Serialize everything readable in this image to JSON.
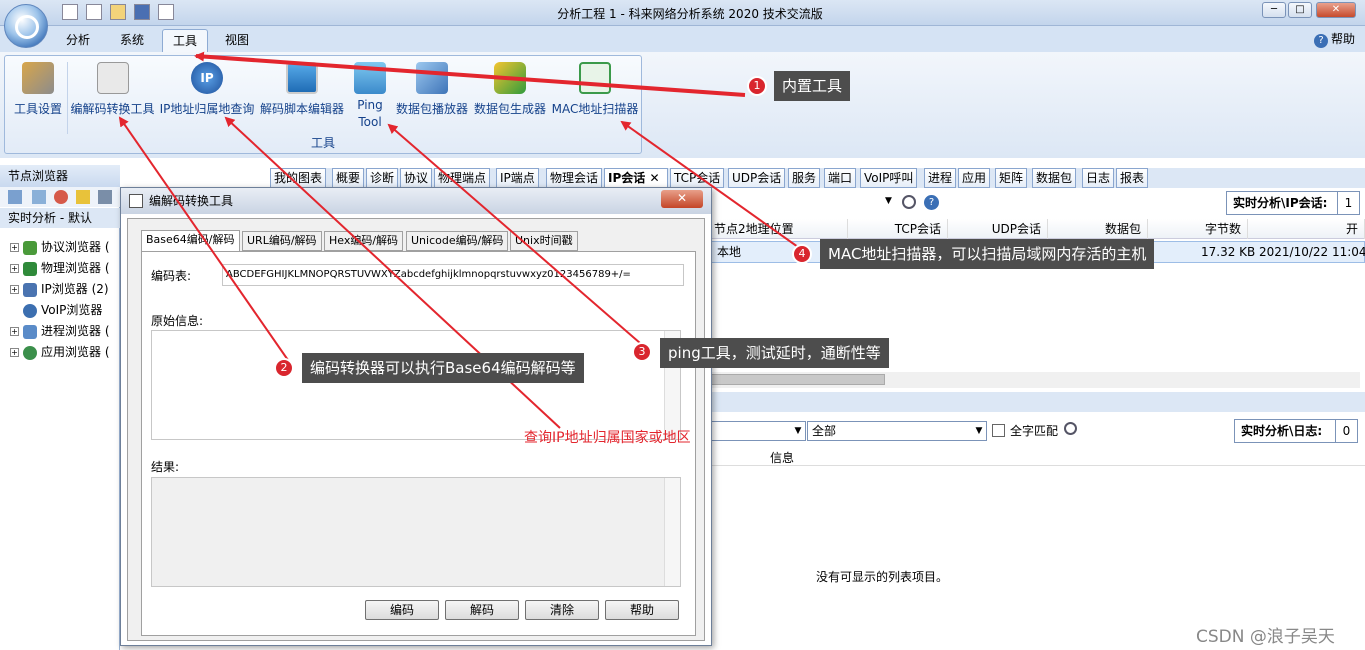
{
  "window": {
    "title": "分析工程 1 - 科来网络分析系统 2020 技术交流版",
    "min": "─",
    "max": "□",
    "close": "✕"
  },
  "menu": {
    "tabs": [
      "分析",
      "系统",
      "工具",
      "视图"
    ],
    "help": "帮助"
  },
  "ribbon": {
    "buttons": [
      "工具设置",
      "编解码转换工具",
      "IP地址归属地查询",
      "解码脚本编辑器",
      "Ping\nTool",
      "数据包播放器",
      "数据包生成器",
      "MAC地址扫描器"
    ],
    "group_label": "工具"
  },
  "node_browser": {
    "title": "节点浏览器",
    "realtime": "实时分析 - 默认",
    "items": [
      "协议浏览器 (",
      "物理浏览器 (",
      "IP浏览器 (2)",
      "VoIP浏览器",
      "进程浏览器 (",
      "应用浏览器 ("
    ]
  },
  "view_tabs": [
    "我的图表",
    "概要",
    "诊断",
    "协议",
    "物理端点",
    "IP端点",
    "物理会话",
    "IP会话",
    "TCP会话",
    "UDP会话",
    "服务",
    "端口",
    "VoIP呼叫",
    "进程",
    "应用",
    "矩阵",
    "数据包",
    "日志",
    "报表"
  ],
  "ip_session": {
    "rt_label": "实时分析\\IP会话:",
    "rt_count": "1",
    "columns": [
      "节点2地理位置",
      "TCP会话",
      "UDP会话",
      "数据包",
      "字节数",
      "开"
    ],
    "row": {
      "location": "本地",
      "bytes": "17.32 KB",
      "time": "2021/10/22 11:04:"
    }
  },
  "log": {
    "filter_all": "全部",
    "full_match": "全字匹配",
    "rt_label": "实时分析\\日志:",
    "rt_count": "0",
    "col_info": "信息",
    "empty": "没有可显示的列表项目。"
  },
  "dialog": {
    "title": "编解码转换工具",
    "close": "✕",
    "tabs": [
      "Base64编码/解码",
      "URL编码/解码",
      "Hex编码/解码",
      "Unicode编码/解码",
      "Unix时间戳"
    ],
    "code_table_label": "编码表:",
    "code_table": "ABCDEFGHIJKLMNOPQRSTUVWXYZabcdefghijklmnopqrstuvwxyz0123456789+/=",
    "original_label": "原始信息:",
    "result_label": "结果:",
    "buttons": [
      "编码",
      "解码",
      "清除",
      "帮助"
    ]
  },
  "annotations": [
    {
      "num": "1",
      "text": "内置工具"
    },
    {
      "num": "2",
      "text": "编码转换器可以执行Base64编码解码等"
    },
    {
      "num": "3",
      "text": "ping工具，测试延时，通断性等"
    },
    {
      "num": "4",
      "text": "MAC地址扫描器，可以扫描局域网内存活的主机"
    }
  ],
  "red_note": "查询IP地址归属国家或地区",
  "watermark": "CSDN @浪子吴天",
  "colors": {
    "annotation_red": "#d9262e",
    "callout_bg": "#4d4d4d",
    "ribbon_text": "#15428b"
  }
}
